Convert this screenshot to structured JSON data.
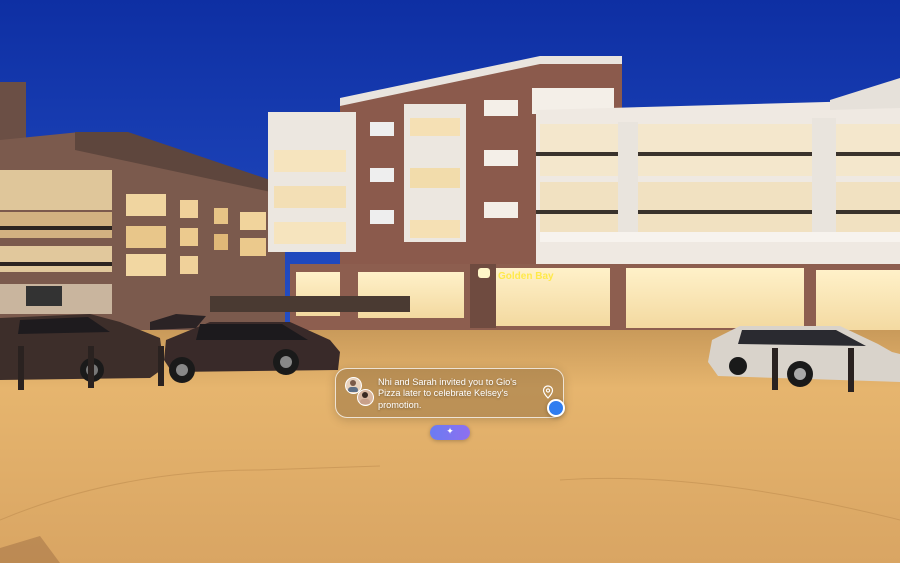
{
  "scene": {
    "storefront_sign": "Golden Bay"
  },
  "notification": {
    "message": "Nhi and Sarah invited you to Gio's Pizza later to celebrate Kelsey's promotion.",
    "avatar_1": "avatar",
    "avatar_2": "avatar",
    "location_icon": "location-pin-icon",
    "position_indicator": "blue-dot"
  },
  "assistant_button": {
    "icon": "sparkle-icon",
    "glyph": "✦",
    "color": "#7a76f1"
  },
  "colors": {
    "sky": "#1438a8",
    "ground": "#e3b068",
    "accent_dot": "#2f7df0"
  }
}
